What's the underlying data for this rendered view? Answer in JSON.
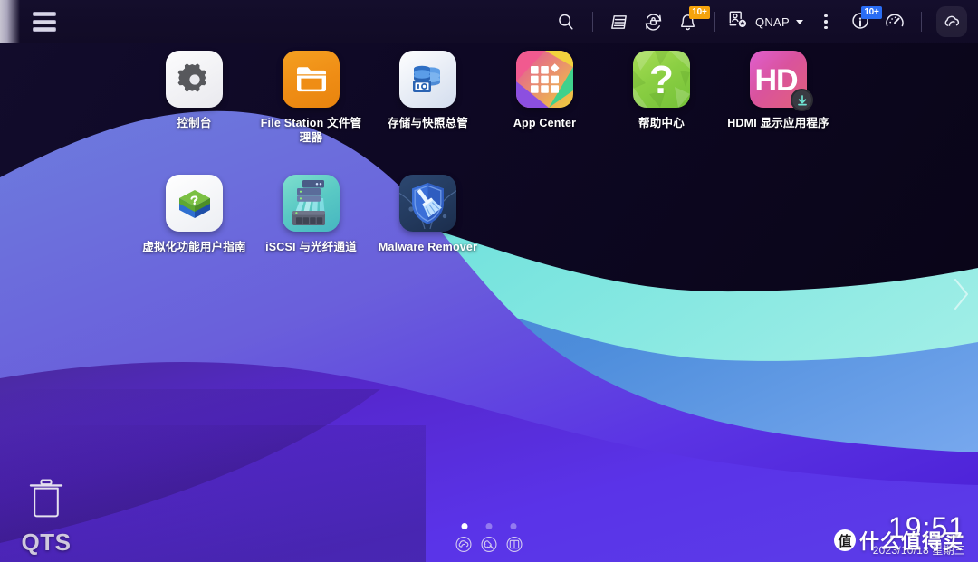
{
  "topbar": {
    "menu_icon": "hamburger-menu-icon",
    "items": [
      {
        "name": "search-icon",
        "label": "搜索",
        "badge": null
      },
      {
        "name": "resource-monitor-icon",
        "label": "资源监控",
        "badge": null
      },
      {
        "name": "backup-sync-icon",
        "label": "备份与同步",
        "badge": null
      },
      {
        "name": "notification-bell-icon",
        "label": "通知",
        "badge": "10+"
      },
      {
        "name": "user-account-icon",
        "label": "QNAP",
        "badge": null
      },
      {
        "name": "more-options-icon",
        "label": "更多",
        "badge": null
      },
      {
        "name": "system-info-icon",
        "label": "系统信息",
        "badge": "10+"
      },
      {
        "name": "dashboard-icon",
        "label": "仪表板",
        "badge": null
      },
      {
        "name": "mycloudnas-icon",
        "label": "myQNAPcloud",
        "badge": null
      }
    ],
    "user_name": "QNAP",
    "bell_badge": "10+",
    "info_badge": "10+",
    "badge_orange": "#f5a30c",
    "badge_blue": "#2a6df4"
  },
  "desktop": {
    "rows": [
      [
        {
          "id": "control-panel",
          "label": "控制台"
        },
        {
          "id": "file-station",
          "label": "File Station 文件管理器"
        },
        {
          "id": "storage-snapshots",
          "label": "存储与快照总管"
        },
        {
          "id": "app-center",
          "label": "App Center"
        },
        {
          "id": "help-center",
          "label": "帮助中心"
        },
        {
          "id": "hdmi-app",
          "label": "HDMI 显示应用程序"
        }
      ],
      [
        {
          "id": "virtualization-guide",
          "label": "虚拟化功能用户指南"
        },
        {
          "id": "iscsi-fibre-channel",
          "label": "iSCSI 与光纤通道"
        },
        {
          "id": "malware-remover",
          "label": "Malware Remover"
        }
      ]
    ]
  },
  "trash": {
    "icon": "trash-can-icon",
    "label": "QTS"
  },
  "dock": {
    "pages": [
      {
        "index": 1,
        "active": true
      },
      {
        "index": 2,
        "active": false
      },
      {
        "index": 3,
        "active": false
      }
    ],
    "icons": [
      {
        "name": "qnap-cloud-icon",
        "label": "云服务"
      },
      {
        "name": "toolbox-wrench-icon",
        "label": "工具"
      },
      {
        "name": "sidebar-panel-icon",
        "label": "面板"
      }
    ]
  },
  "clock": {
    "time": "19:51",
    "date": "2023/10/18 星期三"
  },
  "watermark": {
    "logo_char": "值",
    "text": "什么值得买"
  },
  "page_nav": {
    "next_icon": "chevron-right-icon"
  },
  "colors": {
    "sky_dark": "#0c0721",
    "wave_teal": "#7ae3dd",
    "wave_blue": "#4c8fdd",
    "wave_violet": "#5a3de0",
    "accent_orange": "#f5a30c",
    "accent_blue": "#2a6df4"
  }
}
